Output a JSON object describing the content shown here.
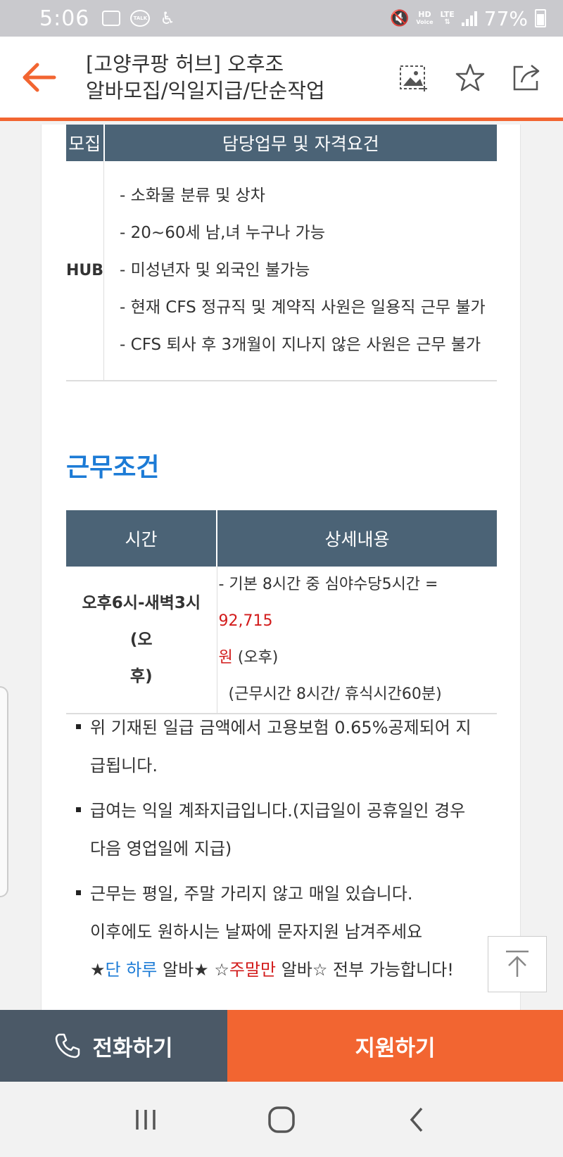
{
  "status_bar": {
    "time": "5:06",
    "icons": [
      "gallery-icon",
      "kakaotalk-icon",
      "accessibility-icon",
      "mute-icon",
      "hd-voice-icon",
      "lte-icon",
      "signal-icon",
      "battery-icon"
    ],
    "talk_label": "TALK",
    "hd_label": "HD",
    "voice_label": "Voice",
    "lte_label": "LTE",
    "battery": "77%"
  },
  "header": {
    "title_line1": "[고양쿠팡 허브] 오후조",
    "title_line2": "알바모집/익일지급/단순작업",
    "accent_color": "#f26531"
  },
  "duty_table": {
    "headers": [
      "모집",
      "담당업무 및 자격요건"
    ],
    "row_label": "HUB",
    "items": [
      "- 소화물 분류 및 상차",
      "- 20~60세 남,녀 누구나 가능",
      "- 미성년자 및 외국인 불가능",
      "- 현재 CFS 정규직 및 계약직 사원은 일용직 근무 불가",
      "- CFS 퇴사 후 3개월이 지나지 않은 사원은 근무 불가"
    ]
  },
  "conditions": {
    "section_title": "근무조건",
    "headers": [
      "시간",
      "상세내용"
    ],
    "time_line1": "오후6시-새벽3시 (오",
    "time_line2": "후)",
    "detail_prefix": "- 기본 8시간 중 심야수당5시간 = ",
    "detail_amount": "92,715",
    "detail_won": "원",
    "detail_suffix": " (오후)",
    "detail_line2": "(근무시간 8시간/ 휴식시간60분)"
  },
  "notes": {
    "n1_line1": "위 기재된 일급 금액에서 고용보험 0.65%공제되어 지",
    "n1_line2": "급됩니다.",
    "n2_line1": "급여는 익일 계좌지급입니다.(지급일이 공휴일인 경우",
    "n2_line2": "다음 영업일에 지급)",
    "n3_line1": "근무는 평일, 주말 가리지 않고 매일 있습니다.",
    "n3_line2": "이후에도 원하시는 날짜에 문자지원 남겨주세요",
    "n3_star_open": "★",
    "n3_one_day": "단 하루",
    "n3_mid": " 알바★ ☆",
    "n3_weekend": "주말만",
    "n3_tail": " 알바☆ 전부 가능합니다!"
  },
  "bottom": {
    "call_label": "전화하기",
    "apply_label": "지원하기",
    "call_color": "#4b5967",
    "apply_color": "#f26531"
  }
}
